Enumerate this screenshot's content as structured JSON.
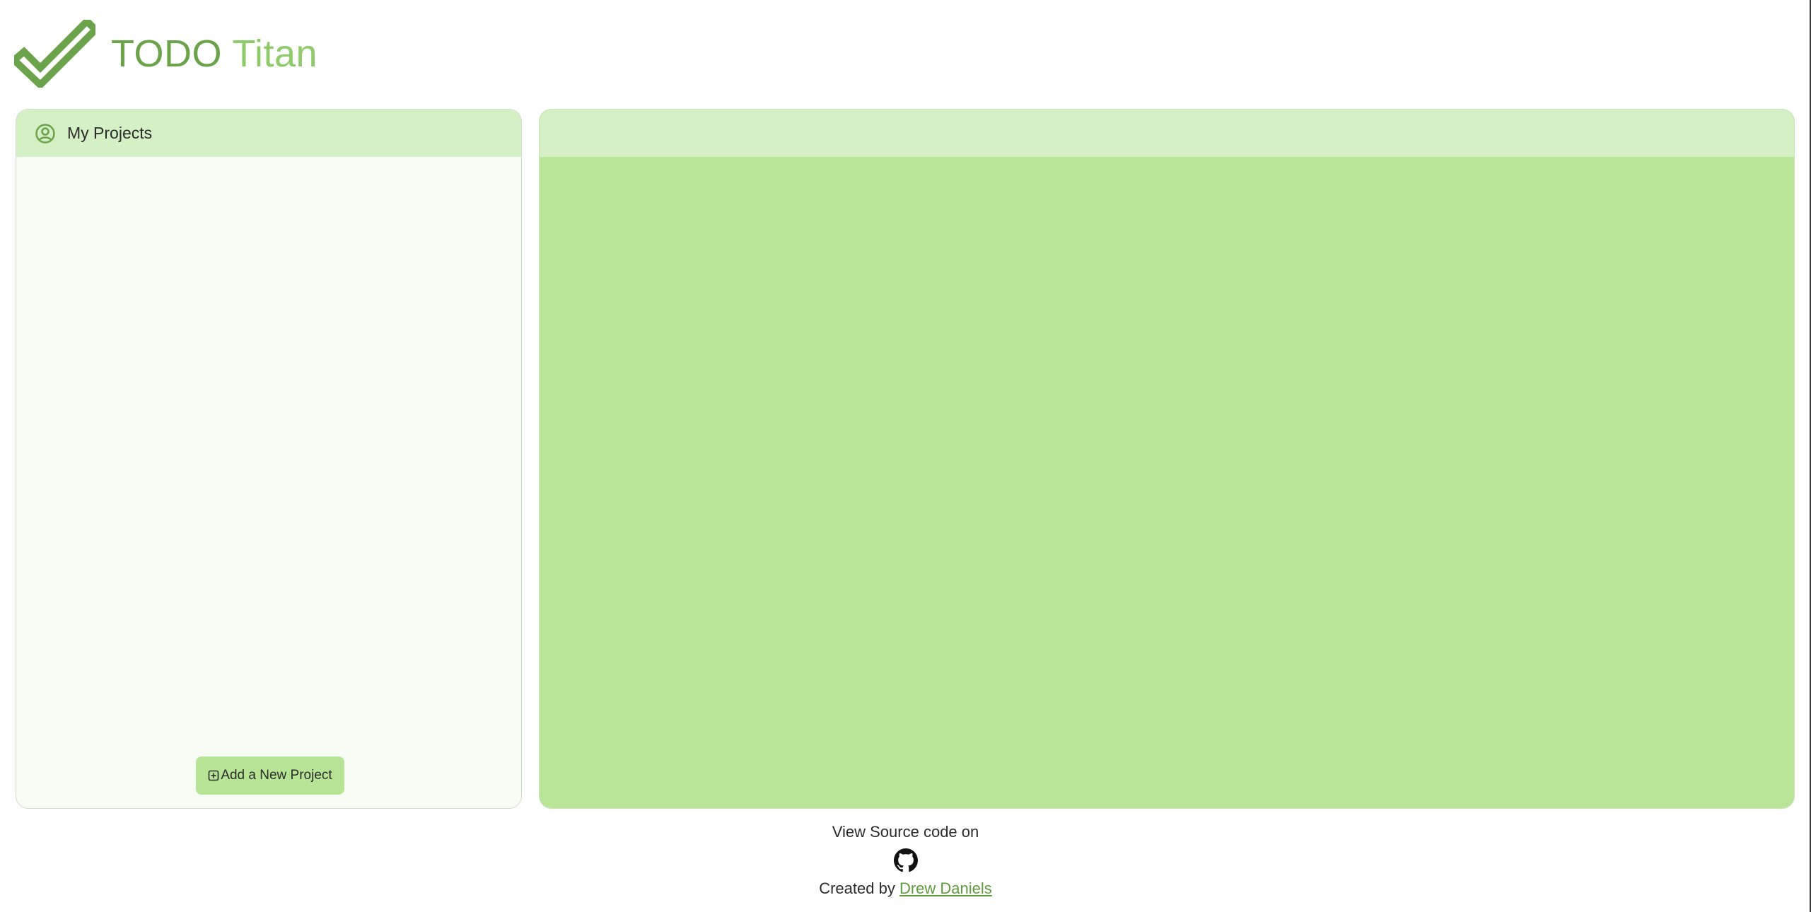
{
  "header": {
    "title_part1": "TODO",
    "title_part2": "Titan",
    "logo_icon": "checkmark-icon"
  },
  "colors": {
    "accent_dark": "#6aa34a",
    "accent_light": "#8fcb6a",
    "panel_header": "#d5f0c4",
    "main_panel_body": "#b8e597",
    "button_bg": "#b7e596",
    "link": "#5f9a3e"
  },
  "projects_panel": {
    "title": "My Projects",
    "icon": "user-circle-icon",
    "items": [],
    "add_button_label": "Add a New Project",
    "add_button_icon": "plus-square-icon"
  },
  "main_panel": {
    "title": ""
  },
  "footer": {
    "source_text": "View Source code on",
    "source_icon": "github-icon",
    "created_by_prefix": "Created by",
    "author_name": "Drew Daniels"
  }
}
